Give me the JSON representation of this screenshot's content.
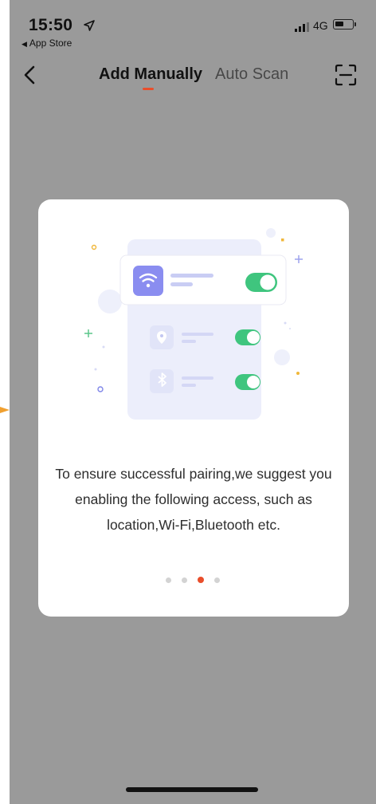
{
  "status_bar": {
    "time": "15:50",
    "back_app": "App Store",
    "network": "4G"
  },
  "nav": {
    "tabs": [
      {
        "label": "Add Manually",
        "selected": true
      },
      {
        "label": "Auto Scan",
        "selected": false
      }
    ]
  },
  "onboarding": {
    "message": "To ensure successful pairing,we suggest you enabling the following access, such as location,Wi-Fi,Bluetooth etc.",
    "page_count": 4,
    "current_page": 3
  },
  "colors": {
    "accent": "#e94e2b",
    "toggle_on": "#3fc57e",
    "wifi_icon_bg": "#8a8df0",
    "card_bg": "#ffffff",
    "overlay_bg": "#9a9a9a"
  },
  "icons": [
    "location-arrow-icon",
    "signal-icon",
    "battery-icon",
    "back-chevron-icon",
    "scan-icon",
    "wifi-icon",
    "location-pin-icon",
    "bluetooth-icon",
    "toggle-switch-icon"
  ]
}
